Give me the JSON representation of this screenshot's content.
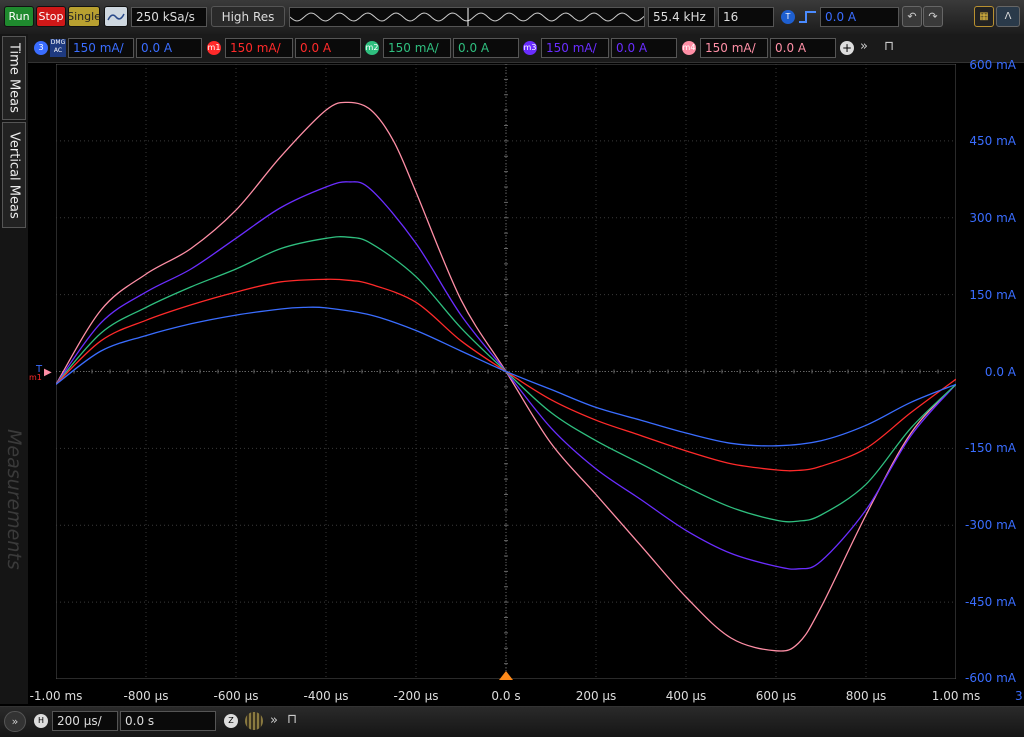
{
  "toolbar": {
    "run_label": "Run",
    "stop_label": "Stop",
    "single_label": "Single",
    "sample_rate": "250 kSa/s",
    "acq_mode": "High Res",
    "frequency": "55.4 kHz",
    "averages": "16",
    "trigger_badge": "T",
    "trigger_level": "0.0 A"
  },
  "channels": [
    {
      "badge": "3",
      "tag": "DMG AC",
      "scale": "150 mA/",
      "offset": "0.0 A",
      "color": "#3a6dff"
    },
    {
      "badge": "m1",
      "scale": "150 mA/",
      "offset": "0.0 A",
      "color": "#ff2a2a"
    },
    {
      "badge": "m2",
      "scale": "150 mA/",
      "offset": "0.0 A",
      "color": "#2fbf7f"
    },
    {
      "badge": "m3",
      "scale": "150 mA/",
      "offset": "0.0 A",
      "color": "#6a2dff"
    },
    {
      "badge": "m4",
      "scale": "150 mA/",
      "offset": "0.0 A",
      "color": "#ff8fa6"
    }
  ],
  "side_tabs": {
    "time": "Time Meas",
    "vertical": "Vertical Meas",
    "measurements": "Measurements"
  },
  "markers": {
    "trigger_label": "T",
    "channel_label": "m1"
  },
  "chart_data": {
    "type": "line",
    "xlabel": "",
    "ylabel": "",
    "x_ticks": [
      "-1.00 ms",
      "-800 µs",
      "-600 µs",
      "-400 µs",
      "-200 µs",
      "0.0 s",
      "200 µs",
      "400 µs",
      "600 µs",
      "800 µs",
      "1.00 ms"
    ],
    "y_ticks": [
      "600 mA",
      "450 mA",
      "300 mA",
      "150 mA",
      "0.0 A",
      "-150 mA",
      "-300 mA",
      "-450 mA",
      "-600 mA"
    ],
    "xlim": [
      -1000,
      1000
    ],
    "ylim": [
      -600,
      600
    ],
    "grid": true,
    "series": [
      {
        "color": "#ff8fa6",
        "x": [
          -1000,
          -900,
          -800,
          -700,
          -600,
          -500,
          -400,
          -350,
          -300,
          -250,
          -200,
          -100,
          0,
          100,
          200,
          300,
          400,
          500,
          600,
          650,
          700,
          800,
          900,
          1000
        ],
        "y": [
          -25,
          120,
          190,
          240,
          315,
          420,
          510,
          525,
          510,
          450,
          350,
          140,
          0,
          -140,
          -240,
          -340,
          -440,
          -520,
          -545,
          -530,
          -460,
          -280,
          -120,
          -25
        ]
      },
      {
        "color": "#6a2dff",
        "x": [
          -1000,
          -900,
          -800,
          -700,
          -600,
          -500,
          -400,
          -350,
          -300,
          -200,
          -100,
          0,
          100,
          200,
          300,
          400,
          500,
          600,
          650,
          700,
          800,
          900,
          1000
        ],
        "y": [
          -25,
          95,
          155,
          200,
          260,
          320,
          360,
          370,
          355,
          250,
          110,
          0,
          -110,
          -190,
          -250,
          -310,
          -355,
          -380,
          -385,
          -370,
          -270,
          -125,
          -25
        ]
      },
      {
        "color": "#2fbf7f",
        "x": [
          -1000,
          -900,
          -800,
          -700,
          -600,
          -500,
          -400,
          -350,
          -300,
          -200,
          -100,
          0,
          100,
          200,
          300,
          400,
          500,
          600,
          650,
          700,
          800,
          900,
          1000
        ],
        "y": [
          -25,
          75,
          125,
          165,
          200,
          240,
          260,
          262,
          250,
          185,
          85,
          0,
          -80,
          -135,
          -180,
          -225,
          -265,
          -290,
          -292,
          -280,
          -220,
          -110,
          -25
        ]
      },
      {
        "color": "#ff2a2a",
        "x": [
          -1000,
          -900,
          -800,
          -700,
          -600,
          -500,
          -400,
          -350,
          -300,
          -200,
          -100,
          0,
          100,
          200,
          300,
          400,
          500,
          600,
          650,
          700,
          800,
          900,
          1000
        ],
        "y": [
          -25,
          60,
          100,
          130,
          155,
          175,
          180,
          178,
          170,
          135,
          60,
          0,
          -55,
          -95,
          -125,
          -155,
          -180,
          -192,
          -193,
          -185,
          -150,
          -80,
          -15
        ]
      },
      {
        "color": "#3a6dff",
        "x": [
          -1000,
          -900,
          -800,
          -700,
          -600,
          -500,
          -450,
          -400,
          -300,
          -200,
          -100,
          0,
          100,
          200,
          300,
          400,
          500,
          600,
          700,
          800,
          900,
          1000
        ],
        "y": [
          -25,
          40,
          70,
          93,
          110,
          122,
          125,
          124,
          110,
          80,
          40,
          0,
          -35,
          -70,
          -95,
          -120,
          -140,
          -145,
          -135,
          -105,
          -60,
          -25
        ]
      }
    ]
  },
  "bottom": {
    "h_badge": "H",
    "timebase": "200 µs/",
    "position": "0.0 s",
    "zoom_badge": "Z"
  },
  "edge_label": "3"
}
